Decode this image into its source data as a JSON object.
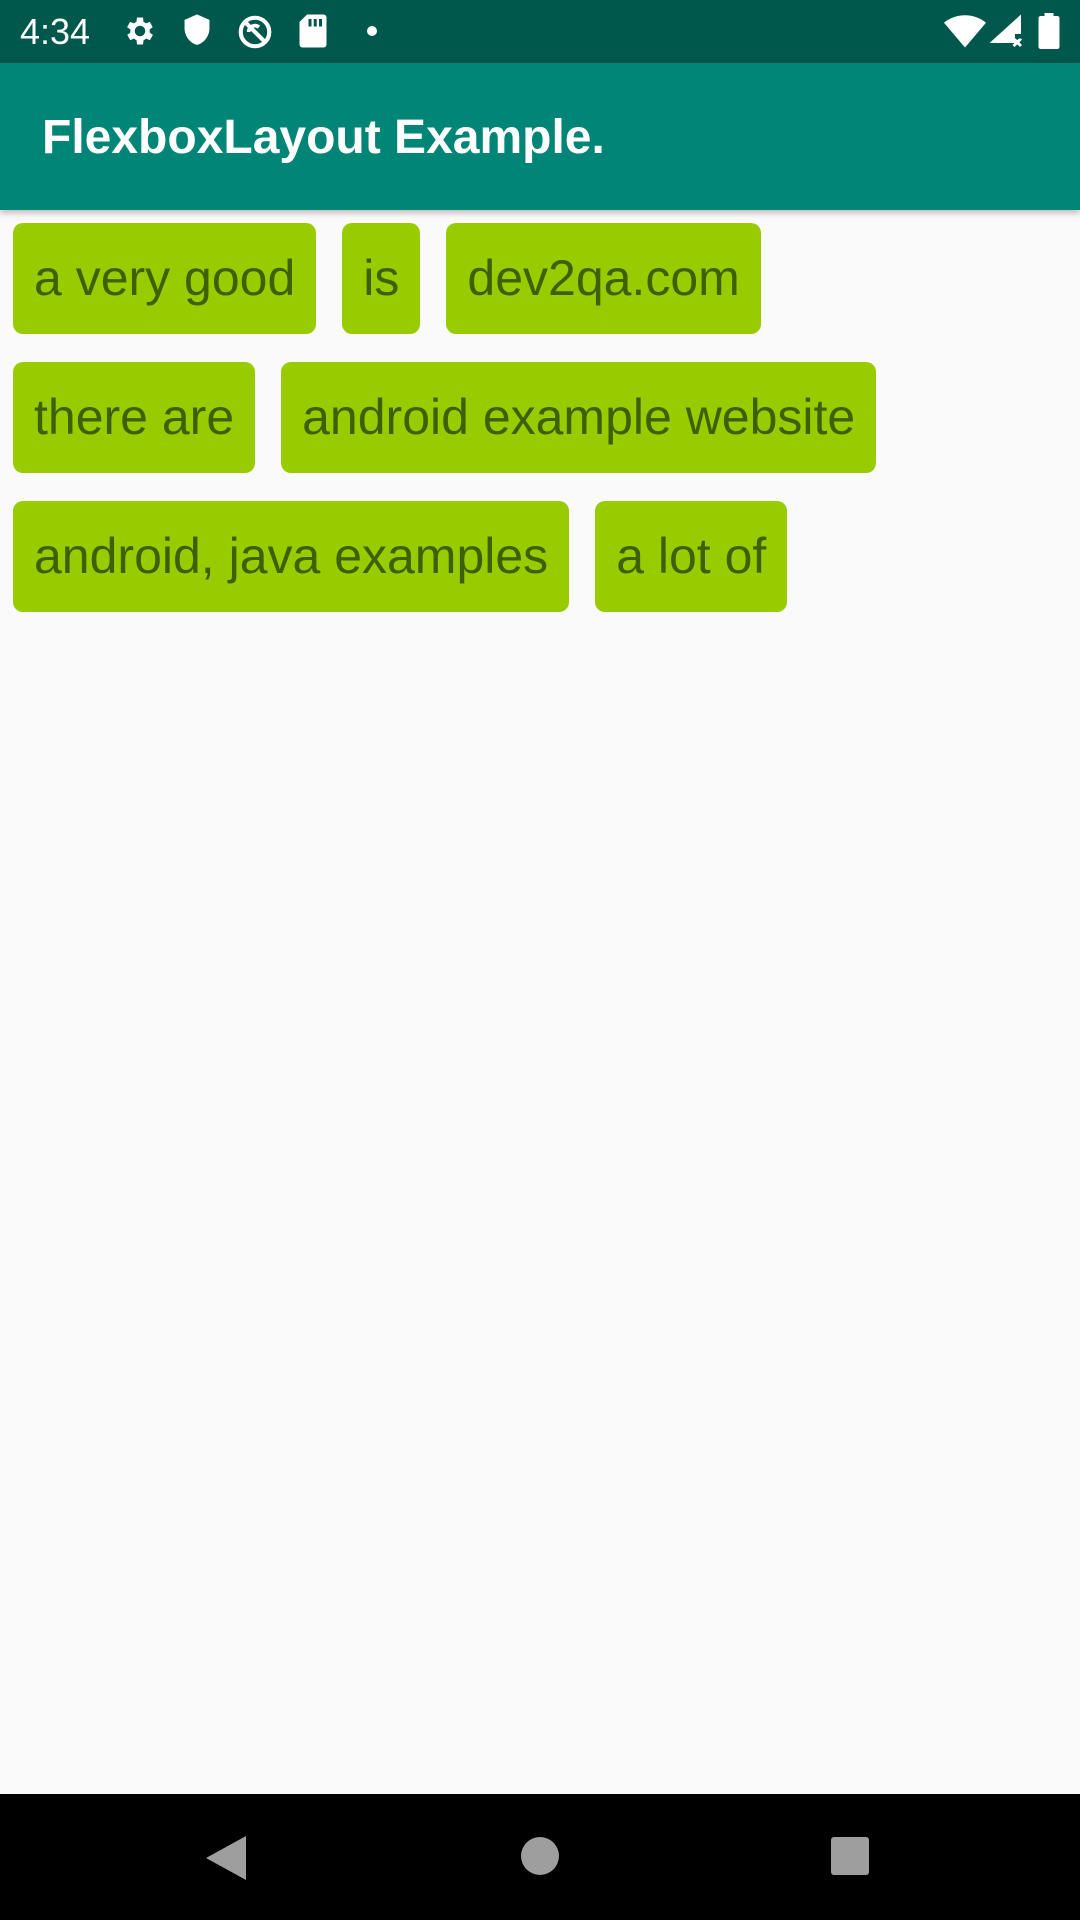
{
  "status_bar": {
    "time": "4:34",
    "icons": [
      "settings-icon",
      "shield-icon",
      "sync-disabled-icon",
      "sd-card-icon",
      "notification-dot-icon",
      "wifi-icon",
      "signal-no-data-icon",
      "battery-icon"
    ],
    "background": "#00574b"
  },
  "app_bar": {
    "title": "FlexboxLayout Example.",
    "background": "#008577"
  },
  "content": {
    "chip_color": "#99cc00",
    "chip_text_color": "#3f6000",
    "items": [
      {
        "label": "a very good"
      },
      {
        "label": "is"
      },
      {
        "label": "dev2qa.com"
      },
      {
        "label": "there are"
      },
      {
        "label": "android example website"
      },
      {
        "label": "android, java examples"
      },
      {
        "label": "a lot of"
      }
    ]
  },
  "nav_bar": {
    "buttons": [
      "back-icon",
      "home-icon",
      "recents-icon"
    ]
  }
}
